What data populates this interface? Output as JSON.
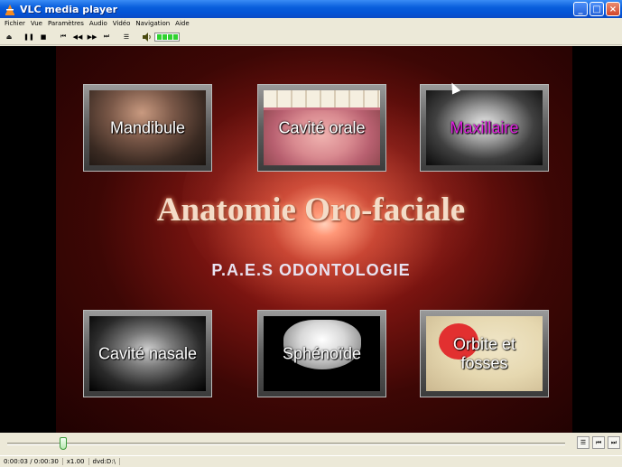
{
  "window": {
    "title": "VLC media player",
    "buttons": {
      "minimize": "_",
      "maximize": "□",
      "close": "×"
    }
  },
  "menubar": {
    "items": [
      "Fichier",
      "Vue",
      "Paramètres",
      "Audio",
      "Vidéo",
      "Navigation",
      "Aide"
    ]
  },
  "toolbar": {
    "eject": "⏏",
    "pause": "❚❚",
    "stop": "■",
    "prev": "⏮",
    "rewind": "◀◀",
    "forward": "▶▶",
    "next": "⏭",
    "playlist": "☰",
    "volume_icon": "🔈",
    "volume_level": 1.0
  },
  "video": {
    "title": "Anatomie Oro-faciale",
    "subtitle": "P.A.E.S ODONTOLOGIE",
    "chapters": [
      {
        "label": "Mandibule",
        "color": "#ffffff"
      },
      {
        "label": "Cavité orale",
        "color": "#ffffff"
      },
      {
        "label": "Maxillaire",
        "color": "#e020e0"
      },
      {
        "label": "Cavité nasale",
        "color": "#ffffff"
      },
      {
        "label": "Sphénoïde",
        "color": "#ffffff"
      },
      {
        "label": "Orbite et fosses",
        "color": "#ffffff"
      }
    ]
  },
  "seek": {
    "progress": 0.1,
    "buttons": {
      "playlist": "☰",
      "prev": "⏮",
      "next": "⏭"
    }
  },
  "status": {
    "time": "0:00:03 / 0:00:30",
    "speed": "x1.00",
    "source": "dvd:D:\\"
  }
}
